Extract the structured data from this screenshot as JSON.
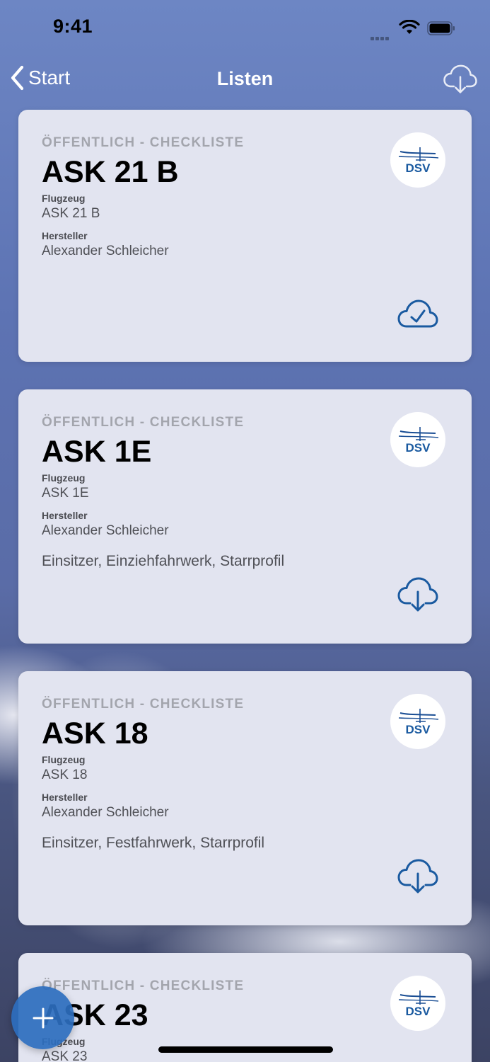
{
  "status_bar": {
    "time": "9:41"
  },
  "nav": {
    "back_label": "Start",
    "title": "Listen"
  },
  "cards": [
    {
      "type_label": "ÖFFENTLICH - CHECKLISTE",
      "title": "ASK 21 B",
      "aircraft_label": "Flugzeug",
      "aircraft_value": "ASK 21 B",
      "manufacturer_label": "Hersteller",
      "manufacturer_value": "Alexander Schleicher",
      "description": "",
      "logo_text": "DSV",
      "status": "downloaded"
    },
    {
      "type_label": "ÖFFENTLICH - CHECKLISTE",
      "title": "ASK 1E",
      "aircraft_label": "Flugzeug",
      "aircraft_value": "ASK 1E",
      "manufacturer_label": "Hersteller",
      "manufacturer_value": "Alexander Schleicher",
      "description": "Einsitzer, Einziehfahrwerk, Starrprofil",
      "logo_text": "DSV",
      "status": "download"
    },
    {
      "type_label": "ÖFFENTLICH - CHECKLISTE",
      "title": "ASK 18",
      "aircraft_label": "Flugzeug",
      "aircraft_value": "ASK 18",
      "manufacturer_label": "Hersteller",
      "manufacturer_value": "Alexander Schleicher",
      "description": "Einsitzer, Festfahrwerk, Starrprofil",
      "logo_text": "DSV",
      "status": "download"
    },
    {
      "type_label": "ÖFFENTLICH - CHECKLISTE",
      "title": "ASK 23",
      "aircraft_label": "Flugzeug",
      "aircraft_value": "ASK 23",
      "logo_text": "DSV"
    }
  ],
  "icons": {
    "back": "chevron-left-icon",
    "nav_action": "cloud-download-icon",
    "downloaded": "cloud-check-icon",
    "download": "cloud-download-icon",
    "fab": "plus-icon"
  },
  "colors": {
    "accent": "#1a5aa0",
    "card_bg": "#e2e4f0",
    "fab": "#2c6ebe"
  }
}
